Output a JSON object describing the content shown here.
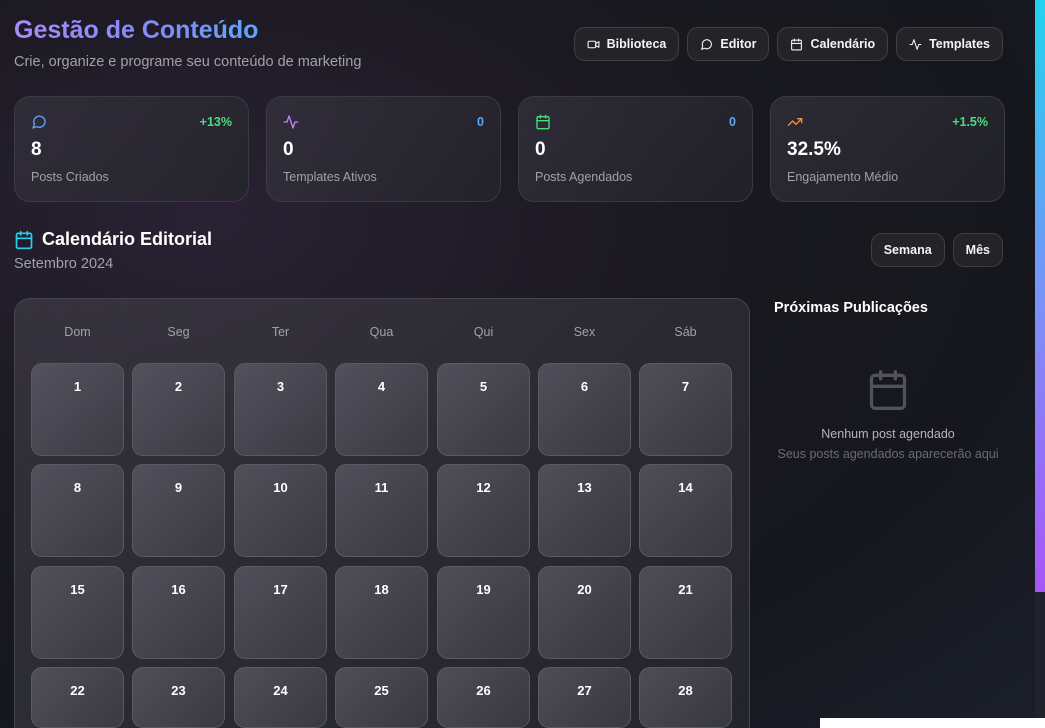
{
  "header": {
    "title": "Gestão de Conteúdo",
    "subtitle": "Crie, organize e programe seu conteúdo de marketing"
  },
  "nav": [
    {
      "label": "Biblioteca",
      "icon": "video-icon"
    },
    {
      "label": "Editor",
      "icon": "message-circle-icon"
    },
    {
      "label": "Calendário",
      "icon": "calendar-icon"
    },
    {
      "label": "Templates",
      "icon": "activity-icon"
    }
  ],
  "stats": [
    {
      "value": "8",
      "label": "Posts Criados",
      "delta": "+13%",
      "delta_color": "#4ade80",
      "icon": "message-circle-icon",
      "icon_color": "#60a5fa"
    },
    {
      "value": "0",
      "label": "Templates Ativos",
      "delta": "0",
      "delta_color": "#60a5fa",
      "icon": "activity-icon",
      "icon_color": "#c084fc"
    },
    {
      "value": "0",
      "label": "Posts Agendados",
      "delta": "0",
      "delta_color": "#60a5fa",
      "icon": "calendar-icon",
      "icon_color": "#4ade80"
    },
    {
      "value": "32.5%",
      "label": "Engajamento Médio",
      "delta": "+1.5%",
      "delta_color": "#4ade80",
      "icon": "trending-up-icon",
      "icon_color": "#fb923c"
    }
  ],
  "calendar": {
    "title": "Calendário Editorial",
    "month": "Setembro 2024",
    "view_week": "Semana",
    "view_month": "Mês",
    "weekdays": [
      "Dom",
      "Seg",
      "Ter",
      "Qua",
      "Qui",
      "Sex",
      "Sáb"
    ],
    "days": [
      "1",
      "2",
      "3",
      "4",
      "5",
      "6",
      "7",
      "8",
      "9",
      "10",
      "11",
      "12",
      "13",
      "14",
      "15",
      "16",
      "17",
      "18",
      "19",
      "20",
      "21",
      "22",
      "23",
      "24",
      "25",
      "26",
      "27",
      "28"
    ]
  },
  "upcoming": {
    "title": "Próximas Publicações",
    "empty_title": "Nenhum post agendado",
    "empty_subtitle": "Seus posts agendados aparecerão aqui"
  },
  "colors": {
    "accent_purple": "#a78bfa",
    "accent_blue": "#60a5fa",
    "positive": "#4ade80"
  }
}
